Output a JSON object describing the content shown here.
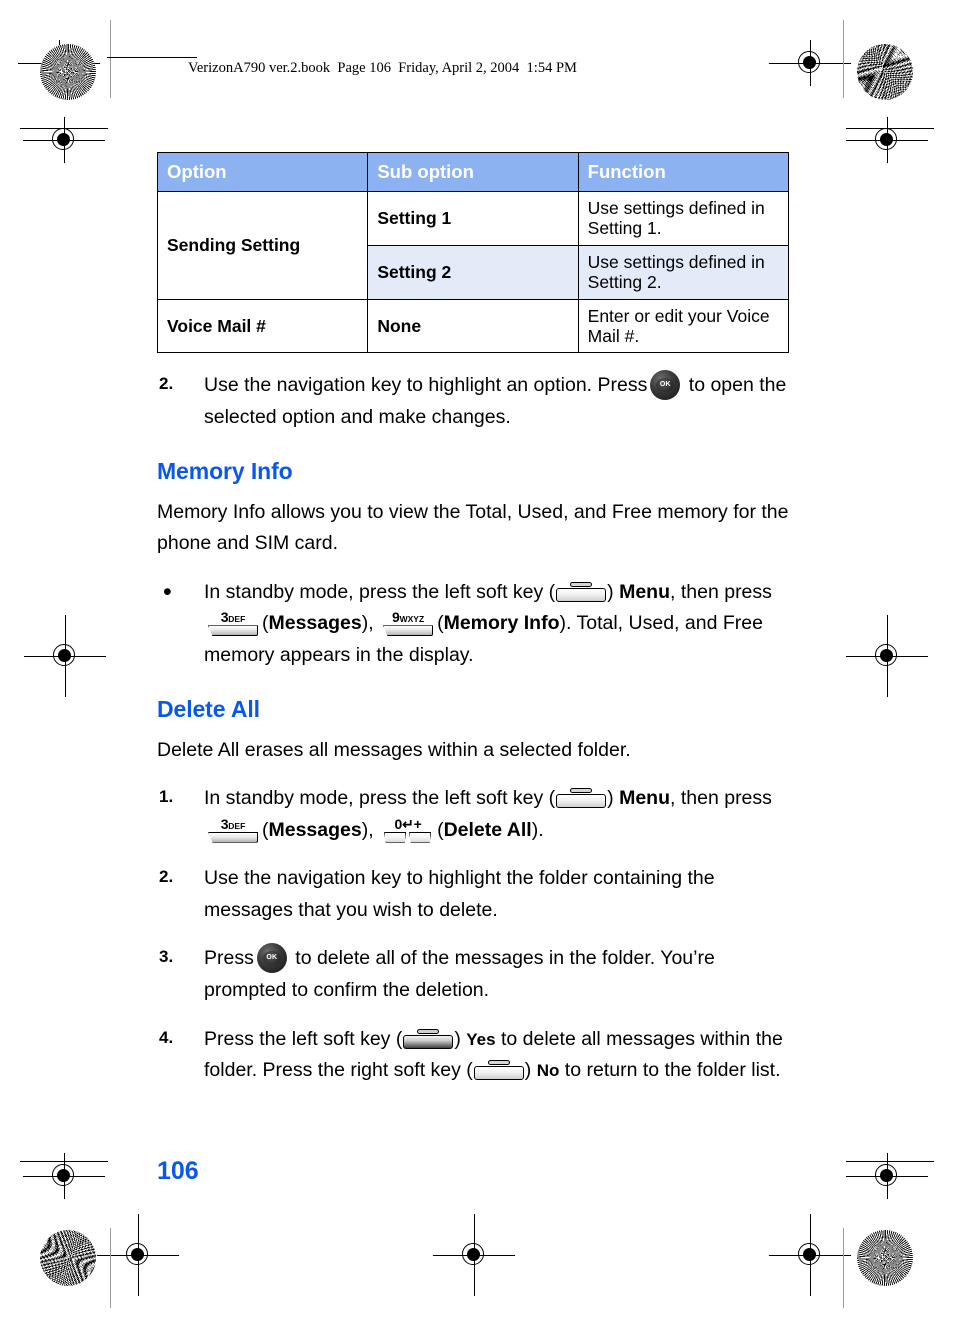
{
  "header": {
    "file_line": "VerizonA790 ver.2.book  Page 106  Friday, April 2, 2004  1:54 PM"
  },
  "colors": {
    "table_header_bg": "#8CB2F2",
    "table_alt_row_bg": "#E3EBF9",
    "heading_blue": "#0A58E8",
    "folio_blue": "#0A58E8",
    "rule_black": "#000000"
  },
  "table": {
    "columns": [
      "Option",
      "Sub option",
      "Function"
    ],
    "rows": [
      {
        "option": "Sending Setting",
        "sub_options": [
          {
            "sub": "Setting 1",
            "function": "Use settings defined in Setting 1."
          },
          {
            "sub": "Setting 2",
            "function": "Use settings defined in Setting 2."
          }
        ]
      },
      {
        "option": "Voice Mail #",
        "sub_options": [
          {
            "sub": "None",
            "function": "Enter or edit your Voice Mail #."
          }
        ]
      }
    ]
  },
  "steps_top": {
    "num": "2.",
    "text_before_key": "Use the navigation key to highlight an option. Press",
    "text_after_key": "to open the selected option and make changes."
  },
  "memory_info": {
    "heading": "Memory Info",
    "paragraph": "Memory Info allows you to view the Total, Used, and Free memory for the phone and SIM card.",
    "bullet": {
      "marker": "•",
      "t1": "In standby mode, press the left soft key (",
      "t2": ") ",
      "menu_label": "Menu",
      "t3": ", then press",
      "t4": "(",
      "messages_label": "Messages",
      "t5": "), ",
      "t6": "(",
      "memory_info_label": "Memory Info",
      "t7": "). Total, Used, and Free memory appears in the display."
    }
  },
  "delete_all": {
    "heading": "Delete All",
    "paragraph": "Delete All erases all messages within a selected folder.",
    "steps": [
      {
        "num": "1.",
        "t1": "In standby mode, press the left soft key (",
        "t2": ") ",
        "menu_label": "Menu",
        "t3": ", then press",
        "t4": "(",
        "messages_label": "Messages",
        "t5": "), ",
        "t6": "(",
        "delete_all_label": "Delete All",
        "t7": ")."
      },
      {
        "num": "2.",
        "text": "Use the navigation key to highlight the folder containing the messages that you wish to delete."
      },
      {
        "num": "3.",
        "t1": "Press",
        "t2": "to delete all of the messages in the folder. You’re prompted to confirm the deletion."
      },
      {
        "num": "4.",
        "t1": "Press the left soft key (",
        "t2": ") ",
        "yes_label": "Yes",
        "t3": " to delete all messages within the folder. Press the right soft key (",
        "t4": ") ",
        "no_label": "No",
        "t5": " to return to the folder list."
      }
    ]
  },
  "keys": {
    "softkey_left": "left-soft-key",
    "softkey_right": "right-soft-key",
    "ok": "OK",
    "key3_digit": "3",
    "key3_letters": "DEF",
    "key9_digit": "9",
    "key9_letters": "WXYZ",
    "key0_digit": "0",
    "key0_symbols": "↵+"
  },
  "folio": {
    "page_number": "106"
  }
}
